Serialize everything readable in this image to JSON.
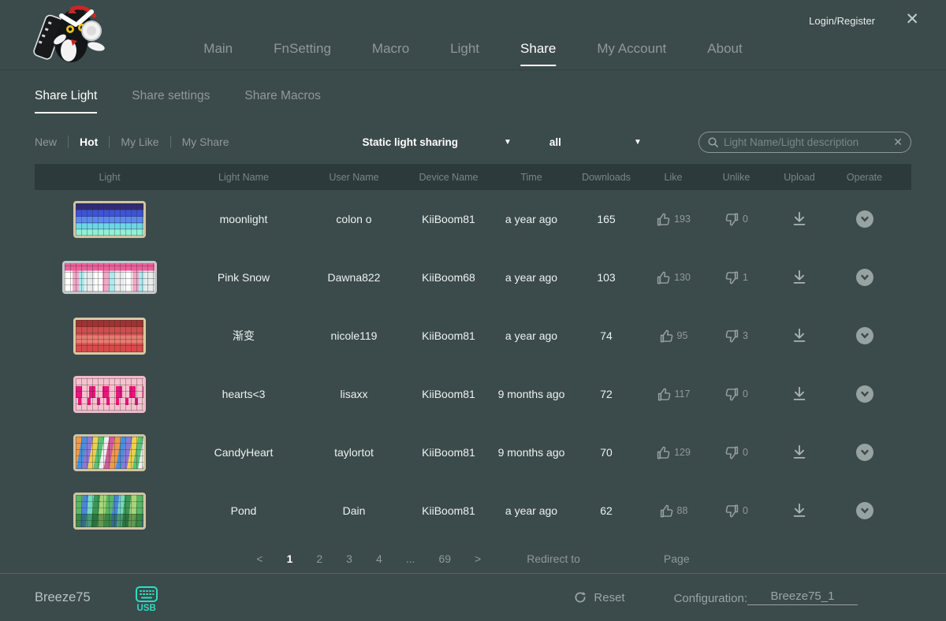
{
  "topbar": {
    "login_label": "Login/Register",
    "close_icon": "✕",
    "nav_items": [
      "Main",
      "FnSetting",
      "Macro",
      "Light",
      "Share",
      "My Account",
      "About"
    ],
    "active_nav": "Share"
  },
  "share_tabs": {
    "tabs": [
      "Share Light",
      "Share settings",
      "Share Macros"
    ],
    "active_tab": "Share Light"
  },
  "filters": {
    "sort_tabs": [
      "New",
      "Hot",
      "My Like",
      "My Share"
    ],
    "active_sort": "Hot",
    "light_type_select": "Static light sharing",
    "device_select": "all",
    "caret_icon": "▼",
    "search_placeholder": "Light Name/Light description",
    "search_value": "",
    "search_clear_icon": "✕"
  },
  "table": {
    "columns": [
      "Light",
      "Light Name",
      "User Name",
      "Device Name",
      "Time",
      "Downloads",
      "Like",
      "Unlike",
      "Upload",
      "Operate"
    ],
    "rows": [
      {
        "light_name": "moonlight",
        "user_name": "colon o",
        "device_name": "KiiBoom81",
        "time": "a year ago",
        "downloads": "165",
        "likes": "193",
        "unlikes": "0",
        "thumbnail": "blue-cyan-gradient-keyboard"
      },
      {
        "light_name": "Pink Snow",
        "user_name": "Dawna822",
        "device_name": "KiiBoom68",
        "time": "a year ago",
        "downloads": "103",
        "likes": "130",
        "unlikes": "1",
        "thumbnail": "pink-white-cyan-keyboard"
      },
      {
        "light_name": "渐变",
        "user_name": "nicole119",
        "device_name": "KiiBoom81",
        "time": "a year ago",
        "downloads": "74",
        "likes": "95",
        "unlikes": "3",
        "thumbnail": "red-gradient-keyboard"
      },
      {
        "light_name": "hearts<3",
        "user_name": "lisaxx",
        "device_name": "KiiBoom81",
        "time": "9 months ago",
        "downloads": "72",
        "likes": "117",
        "unlikes": "0",
        "thumbnail": "pink-hearts-keyboard"
      },
      {
        "light_name": "CandyHeart",
        "user_name": "taylortot",
        "device_name": "KiiBoom81",
        "time": "9 months ago",
        "downloads": "70",
        "likes": "129",
        "unlikes": "0",
        "thumbnail": "multicolor-candy-keyboard"
      },
      {
        "light_name": "Pond",
        "user_name": "Dain",
        "device_name": "KiiBoom81",
        "time": "a year ago",
        "downloads": "62",
        "likes": "88",
        "unlikes": "0",
        "thumbnail": "green-blue-pond-keyboard"
      }
    ]
  },
  "pagination": {
    "prev": "<",
    "next": ">",
    "pages": [
      "1",
      "2",
      "3",
      "4",
      "...",
      "69"
    ],
    "active_page": "1",
    "redirect_label": "Redirect to",
    "page_label": "Page"
  },
  "footer": {
    "device_name": "Breeze75",
    "connection_label": "USB",
    "reset_label": "Reset",
    "config_label": "Configuration:",
    "config_value": "Breeze75_1"
  },
  "colors": {
    "background": "#3b4a4b",
    "table_header_bg": "#2d3a3b",
    "accent_teal": "#2bdfc2",
    "text_primary": "#f2f5f5",
    "text_muted": "#8e9a9a"
  }
}
